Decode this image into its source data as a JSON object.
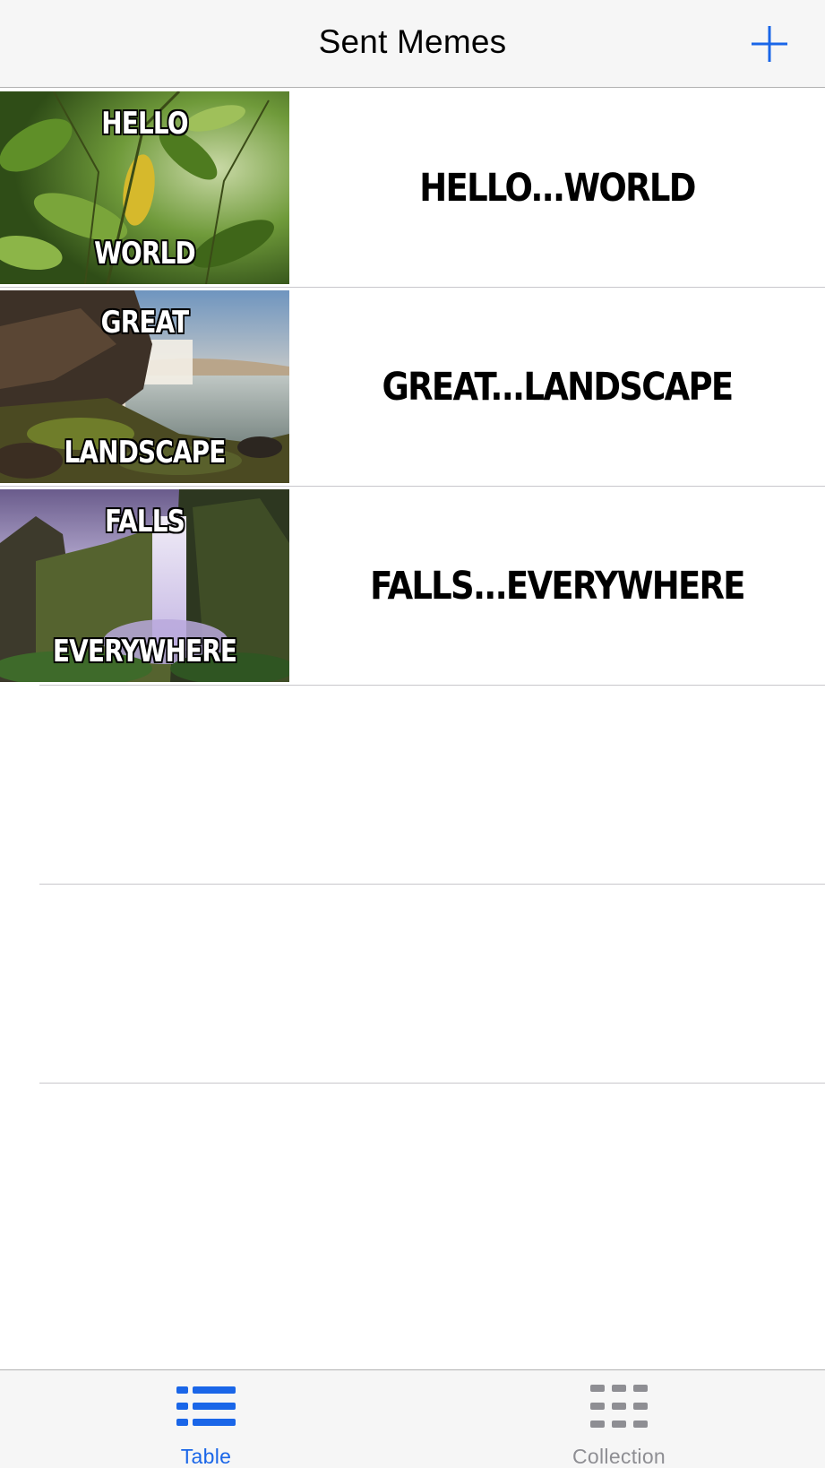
{
  "nav": {
    "title": "Sent Memes",
    "add_icon": "plus-icon"
  },
  "memes": [
    {
      "top": "HELLO",
      "bottom": "WORLD",
      "label": "HELLO...WORLD"
    },
    {
      "top": "GREAT",
      "bottom": "LANDSCAPE",
      "label": "GREAT...LANDSCAPE"
    },
    {
      "top": "FALLS",
      "bottom": "EVERYWHERE",
      "label": "FALLS...EVERYWHERE"
    }
  ],
  "tabs": [
    {
      "label": "Table",
      "icon": "list-icon",
      "selected": true
    },
    {
      "label": "Collection",
      "icon": "grid-icon",
      "selected": false
    }
  ],
  "colors": {
    "accent": "#1a66e8",
    "inactive": "#8e8e93",
    "bar_background": "#f6f6f6",
    "separator": "#c8c7cc"
  }
}
